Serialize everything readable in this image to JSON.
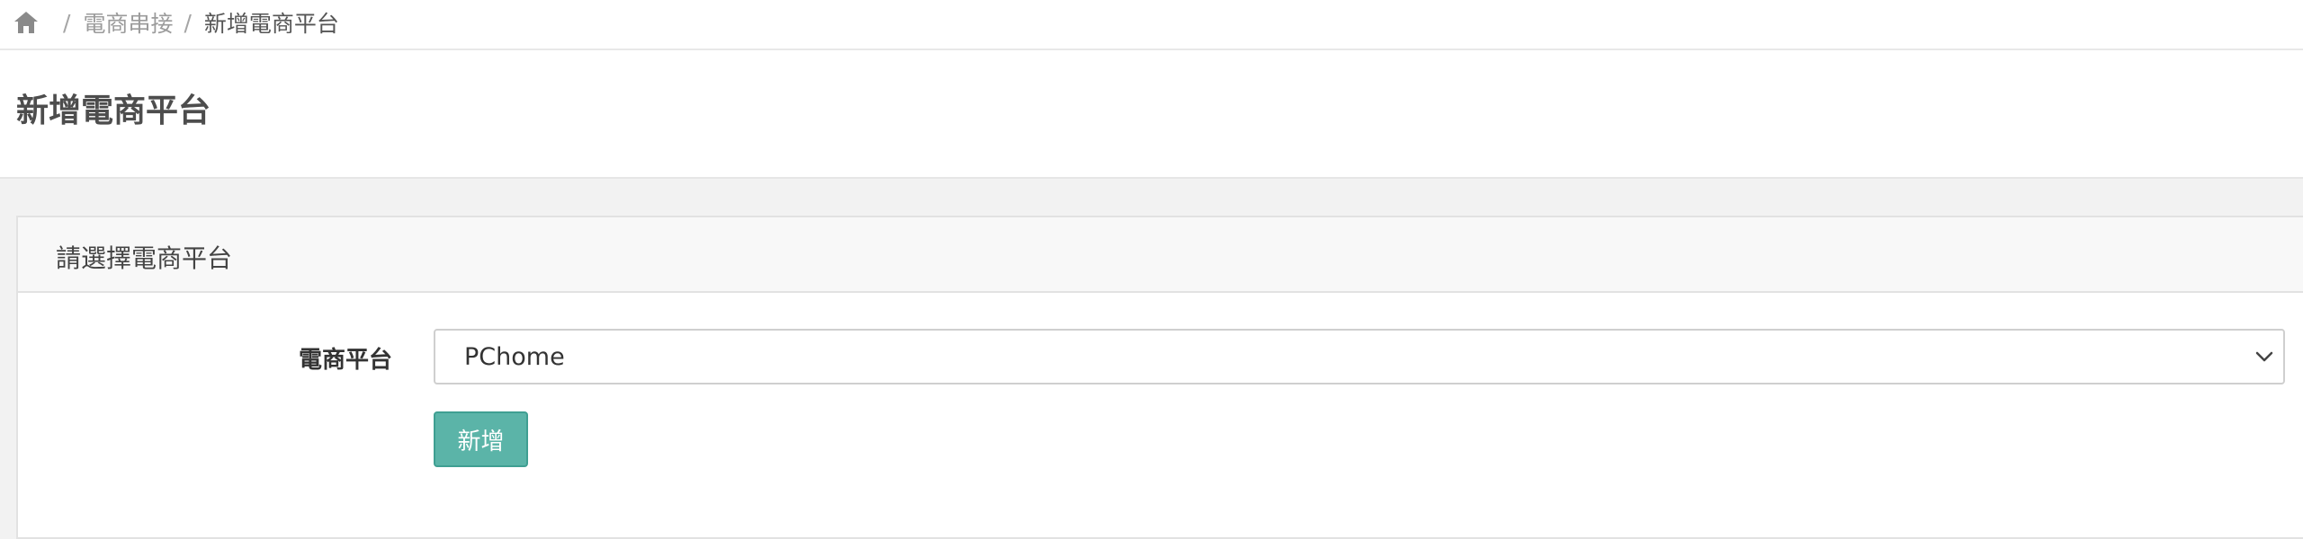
{
  "breadcrumb": {
    "home_icon": "home-icon",
    "separator": "/",
    "items": [
      {
        "label": "電商串接"
      },
      {
        "label": "新增電商平台"
      }
    ]
  },
  "page": {
    "title": "新增電商平台"
  },
  "panel": {
    "title": "請選擇電商平台",
    "platform_field": {
      "label": "電商平台",
      "selected_value": "PChome",
      "icon": "chevron-down-icon"
    },
    "submit_label": "新增"
  },
  "colors": {
    "primary_button": "#5bb4a8",
    "page_background": "#f2f2f2"
  }
}
